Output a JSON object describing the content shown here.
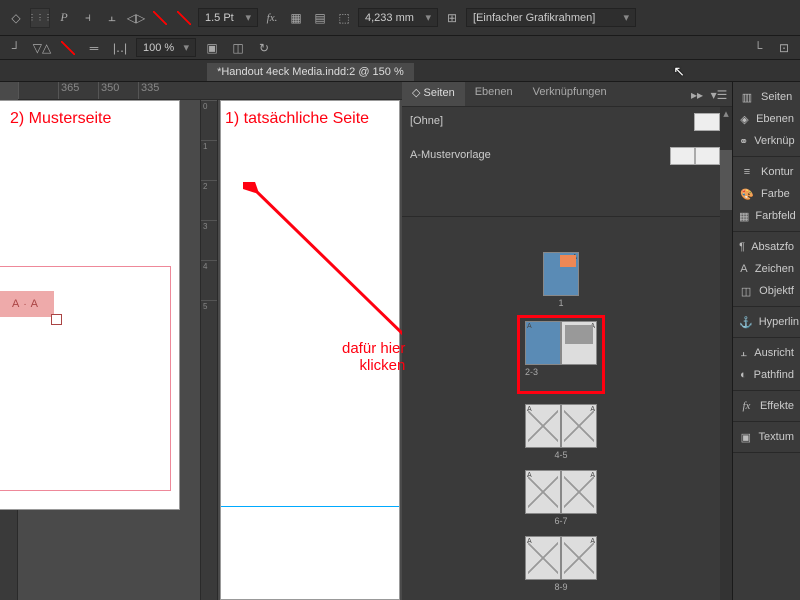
{
  "toolbar": {
    "stroke_width": "1.5 Pt",
    "percent": "100 %",
    "measure": "4,233 mm",
    "frame_preset": "[Einfacher Grafikrahmen]",
    "fx_label": "fx.",
    "p_label": "P"
  },
  "document": {
    "tab_title": "*Handout 4eck Media.indd:2 @ 150 %"
  },
  "ruler_h": [
    "",
    "365",
    "350",
    "335"
  ],
  "ruler_v1": [
    "",
    "0",
    "1",
    "2",
    "3"
  ],
  "ruler_v2": [
    "0",
    "1",
    "2",
    "3",
    "4",
    "5"
  ],
  "canvas": {
    "annot_master": "2) Musterseite",
    "annot_page": "1) tatsächliche Seite",
    "annot_click": "dafür hier\nklicken",
    "letter_A": "A"
  },
  "pages_panel": {
    "tabs": [
      "Seiten",
      "Ebenen",
      "Verknüpfungen"
    ],
    "none_label": "[Ohne]",
    "master_label": "A-Mustervorlage",
    "spreads": [
      {
        "num": "1",
        "single": true
      },
      {
        "num": "2-3",
        "highlight": true,
        "blue_left": true
      },
      {
        "num": "4-5"
      },
      {
        "num": "6-7"
      },
      {
        "num": "8-9"
      }
    ]
  },
  "right_panel": {
    "groups": [
      [
        "Seiten",
        "Ebenen",
        "Verknüp"
      ],
      [
        "Kontur",
        "Farbe",
        "Farbfeld"
      ],
      [
        "Absatzfo",
        "Zeichen",
        "Objektf"
      ],
      [
        "Hyperlin"
      ],
      [
        "Ausricht",
        "Pathfind"
      ],
      [
        "Effekte"
      ],
      [
        "Textum"
      ]
    ]
  }
}
